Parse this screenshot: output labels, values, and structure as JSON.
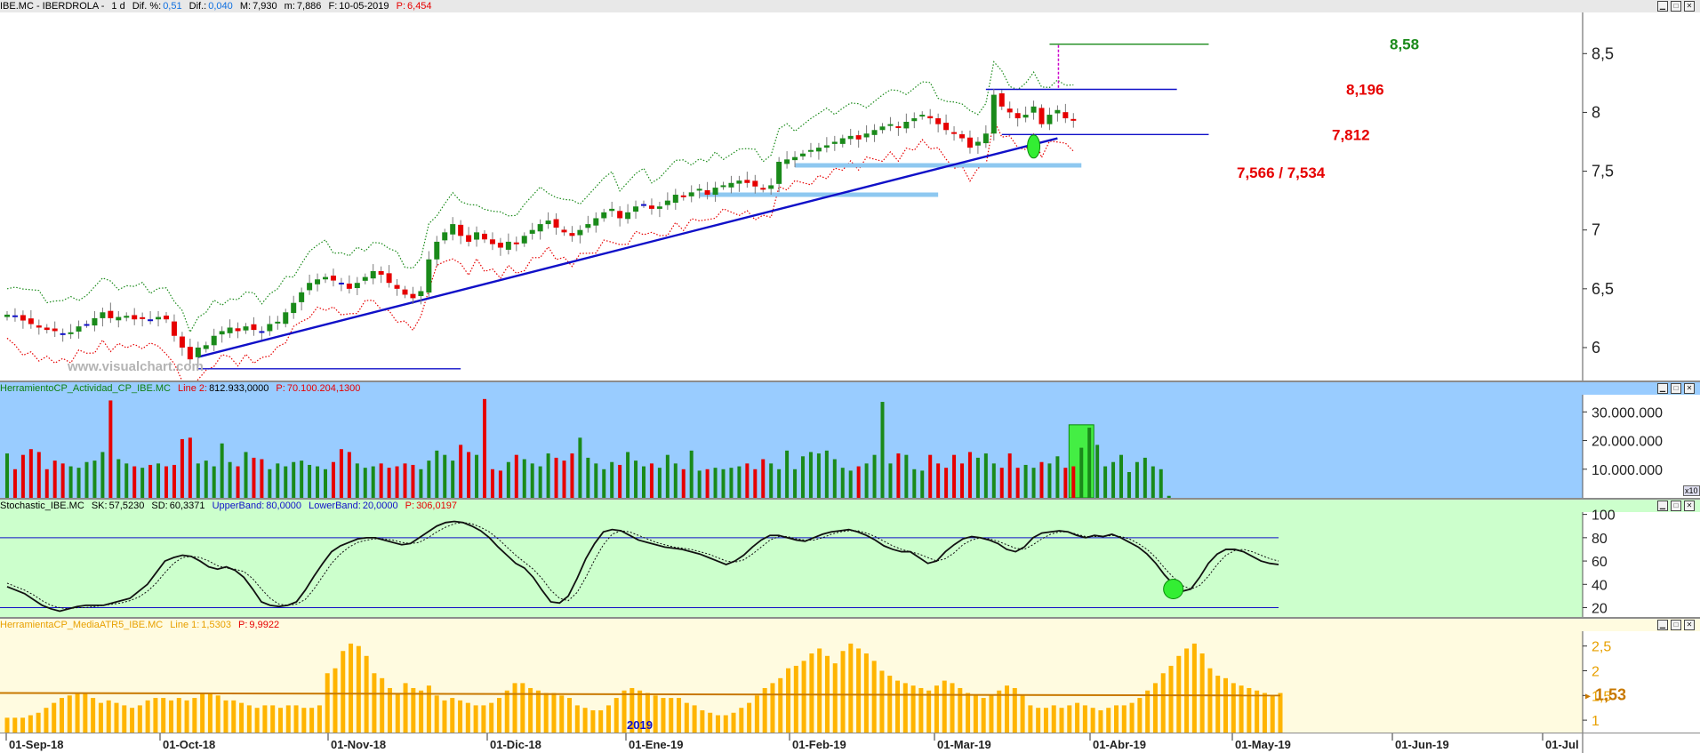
{
  "panes": {
    "price": {
      "header": {
        "symbol": "IBE.MC - IBERDROLA -",
        "period": "1 d",
        "dif_pct_label": "Dif. %:",
        "dif_pct": "0,51",
        "dif_label": "Dif.:",
        "dif": "0,040",
        "max_label": "M:",
        "max": "7,930",
        "min_label": "m:",
        "min": "7,886",
        "date_label": "F:",
        "date": "10-05-2019",
        "p_label": "P:",
        "p": "6,454"
      },
      "watermark": "www.visualchart.com",
      "annotations": [
        {
          "text": "8,58",
          "value": 8.58,
          "color": "#1a8a1a"
        },
        {
          "text": "8,196",
          "value": 8.196,
          "color": "#e60000"
        },
        {
          "text": "7,812",
          "value": 7.812,
          "color": "#e60000"
        },
        {
          "text": "7,566 / 7,534",
          "value": 7.55,
          "color": "#e60000"
        }
      ]
    },
    "volume": {
      "header": {
        "name": "HerramientoCP_Actividad_CP_IBE.MC",
        "line_label": "Line 2:",
        "line": "812.933,0000",
        "p_label": "P:",
        "p": "70.100.204,1300"
      },
      "multiplier": "x10"
    },
    "stochastic": {
      "header": {
        "name": "Stochastic_IBE.MC",
        "sk_label": "SK:",
        "sk": "57,5230",
        "sd_label": "SD:",
        "sd": "60,3371",
        "ub_label": "UpperBand:",
        "ub": "80,0000",
        "lb_label": "LowerBand:",
        "lb": "20,0000",
        "p_label": "P:",
        "p": "306,0197"
      }
    },
    "atr": {
      "header": {
        "name": "HerramientaCP_MediaATR5_IBE.MC",
        "line_label": "Line 1:",
        "line": "1,5303",
        "p_label": "P:",
        "p": "9,9922"
      },
      "current_label": "1,53"
    }
  },
  "x_axis": {
    "labels": [
      "01-Sep-18",
      "01-Oct-18",
      "01-Nov-18",
      "01-Dic-18",
      "01-Ene-19",
      "01-Feb-19",
      "01-Mar-19",
      "01-Abr-19",
      "01-May-19",
      "01-Jun-19",
      "01-Jul"
    ],
    "year_marker": "2019"
  },
  "colors": {
    "up": "#1a8a1a",
    "down": "#e60000",
    "neutral": "#1010c8",
    "trend": "#1010c8",
    "support_band": "#8ec8f0",
    "volume_bg": "#99ccff",
    "stoch_bg": "#ccffcc",
    "atr_bg": "#fffbe0",
    "atr_bar": "#ffb400",
    "atr_avg": "#c87800",
    "highlight": "#33ee33"
  },
  "chart_data": [
    {
      "type": "candlestick",
      "title": "IBE.MC - IBERDROLA",
      "ylim": [
        5.72,
        8.85
      ],
      "y_ticks": [
        {
          "value": 6,
          "label": "6"
        },
        {
          "value": 6.5,
          "label": "6,5"
        },
        {
          "value": 7,
          "label": "7"
        },
        {
          "value": 7.5,
          "label": "7,5"
        },
        {
          "value": 8,
          "label": "8"
        },
        {
          "value": 8.5,
          "label": "8,5"
        }
      ],
      "close": [
        6.28,
        6.27,
        6.23,
        6.2,
        6.17,
        6.15,
        6.14,
        6.12,
        6.13,
        6.18,
        6.2,
        6.25,
        6.3,
        6.25,
        6.26,
        6.27,
        6.24,
        6.25,
        6.24,
        6.26,
        6.24,
        6.1,
        6.0,
        5.9,
        6.0,
        6.02,
        6.1,
        6.14,
        6.17,
        6.14,
        6.18,
        6.15,
        6.14,
        6.2,
        6.22,
        6.3,
        6.38,
        6.47,
        6.55,
        6.58,
        6.6,
        6.57,
        6.55,
        6.5,
        6.55,
        6.6,
        6.65,
        6.62,
        6.55,
        6.5,
        6.45,
        6.42,
        6.48,
        6.75,
        6.9,
        6.98,
        7.05,
        6.95,
        6.9,
        6.98,
        6.92,
        6.88,
        6.85,
        6.9,
        6.88,
        6.95,
        7.0,
        7.05,
        7.08,
        7.02,
        6.98,
        6.95,
        7.0,
        7.05,
        7.1,
        7.15,
        7.18,
        7.1,
        7.15,
        7.2,
        7.22,
        7.18,
        7.2,
        7.25,
        7.3,
        7.28,
        7.32,
        7.35,
        7.3,
        7.36,
        7.38,
        7.4,
        7.42,
        7.4,
        7.37,
        7.35,
        7.38,
        7.58,
        7.6,
        7.62,
        7.65,
        7.68,
        7.7,
        7.72,
        7.75,
        7.78,
        7.8,
        7.77,
        7.82,
        7.85,
        7.88,
        7.9,
        7.87,
        7.92,
        7.95,
        7.98,
        7.95,
        7.9,
        7.85,
        7.82,
        7.78,
        7.7,
        7.75,
        7.82,
        8.15,
        8.05,
        8.0,
        7.95,
        7.98,
        8.05,
        7.9,
        7.98,
        8.02,
        7.95,
        7.93
      ],
      "series": [
        {
          "name": "Upper envelope",
          "color": "#1a8a1a",
          "style": "dotted"
        },
        {
          "name": "Lower envelope",
          "color": "#e60000",
          "style": "dotted"
        }
      ],
      "trendline": {
        "from": {
          "index": 24,
          "value": 5.92
        },
        "to": {
          "index": 132,
          "value": 7.78
        }
      },
      "horizontal_levels": [
        {
          "value": 5.82,
          "from_index": 24,
          "to_index": 57,
          "color": "#1010c8"
        },
        {
          "value": 7.3,
          "from_index": 87,
          "to_index": 117,
          "color": "#8ec8f0"
        },
        {
          "value": 7.55,
          "from_index": 99,
          "to_index": 135,
          "color": "#8ec8f0"
        },
        {
          "value": 7.812,
          "from_index": 125,
          "to_index": 151,
          "color": "#1010c8"
        },
        {
          "value": 8.196,
          "from_index": 123,
          "to_index": 147,
          "color": "#1010c8"
        },
        {
          "value": 8.58,
          "from_index": 131,
          "to_index": 151,
          "color": "#1a8a1a"
        }
      ]
    },
    {
      "type": "bar",
      "title": "HerramientoCP_Actividad_CP_IBE.MC",
      "ylim": [
        0,
        36000000
      ],
      "y_ticks": [
        {
          "value": 10000000,
          "label": "10.000.000"
        },
        {
          "value": 20000000,
          "label": "20.000.000"
        },
        {
          "value": 30000000,
          "label": "30.000.000"
        }
      ],
      "values": [
        15500000,
        10000000,
        15000000,
        17000000,
        16000000,
        10000000,
        13000000,
        12000000,
        11000000,
        10500000,
        12500000,
        13000000,
        16000000,
        34000000,
        13500000,
        12000000,
        11000000,
        10500000,
        11500000,
        12000000,
        11000000,
        11500000,
        20500000,
        21000000,
        12000000,
        13000000,
        11000000,
        19000000,
        12500000,
        11000000,
        16000000,
        14000000,
        13500000,
        10000000,
        12000000,
        11000000,
        12500000,
        13000000,
        11500000,
        11000000,
        10000000,
        12500000,
        17000000,
        16000000,
        12000000,
        10500000,
        11000000,
        12000000,
        10500000,
        11000000,
        12000000,
        11500000,
        10000000,
        13000000,
        16500000,
        15000000,
        13000000,
        18500000,
        16000000,
        15000000,
        34500000,
        10000000,
        9500000,
        12500000,
        15000000,
        13500000,
        12000000,
        11000000,
        15500000,
        14000000,
        13000000,
        15500000,
        21000000,
        14000000,
        12000000,
        10000000,
        12500000,
        11500000,
        16000000,
        13000000,
        11000000,
        12000000,
        10500000,
        15000000,
        12000000,
        10000000,
        16500000,
        9500000,
        10000000,
        10500000,
        10000000,
        10500000,
        11000000,
        12000000,
        10000000,
        13500000,
        12000000,
        10000000,
        16500000,
        10000000,
        14500000,
        16000000,
        15500000,
        16500000,
        13500000,
        10500000,
        9500000,
        11000000,
        12000000,
        15000000,
        33500000,
        12000000,
        15500000,
        15000000,
        10000000,
        9500000,
        15000000,
        12000000,
        10500000,
        15000000,
        12000000,
        16000000,
        14000000,
        15500000,
        12000000,
        10500000,
        15500000,
        10500000,
        11500000,
        10500000,
        12500000,
        12000000,
        14500000,
        10500000,
        11000000,
        17500000,
        24500000,
        18500000,
        11000000,
        12500000,
        15000000,
        9000000,
        12500000,
        14000000,
        11000000,
        10000000,
        700000
      ],
      "highlight_index_range": [
        134,
        136
      ]
    },
    {
      "type": "line",
      "title": "Stochastic_IBE.MC",
      "ylim": [
        12,
        102
      ],
      "y_ticks": [
        {
          "value": 20,
          "label": "20"
        },
        {
          "value": 40,
          "label": "40"
        },
        {
          "value": 60,
          "label": "60"
        },
        {
          "value": 80,
          "label": "80"
        },
        {
          "value": 100,
          "label": "100"
        }
      ],
      "bands": [
        80,
        20
      ],
      "series": [
        {
          "name": "SK",
          "style": "solid",
          "values": [
            38,
            35,
            32,
            27,
            22,
            19,
            17,
            19,
            21,
            22,
            22,
            22,
            24,
            26,
            28,
            34,
            40,
            50,
            60,
            63,
            65,
            64,
            60,
            55,
            53,
            55,
            52,
            46,
            36,
            25,
            22,
            21,
            22,
            25,
            35,
            47,
            58,
            68,
            73,
            76,
            79,
            80,
            80,
            78,
            76,
            74,
            75,
            80,
            85,
            90,
            93,
            94,
            93,
            90,
            86,
            80,
            72,
            65,
            58,
            54,
            46,
            35,
            25,
            24,
            30,
            45,
            62,
            75,
            85,
            87,
            86,
            82,
            78,
            76,
            74,
            72,
            71,
            70,
            68,
            66,
            63,
            60,
            57,
            60,
            65,
            72,
            78,
            82,
            82,
            80,
            78,
            77,
            80,
            83,
            85,
            86,
            87,
            85,
            82,
            78,
            73,
            70,
            68,
            68,
            63,
            58,
            60,
            68,
            74,
            79,
            81,
            80,
            78,
            75,
            70,
            68,
            72,
            80,
            84,
            85,
            86,
            85,
            82,
            80,
            82,
            81,
            83,
            80,
            76,
            72,
            66,
            58,
            48,
            40,
            34,
            36,
            46,
            58,
            66,
            70,
            70,
            68,
            64,
            60,
            58,
            57
          ]
        },
        {
          "name": "SD",
          "style": "dotted",
          "values": [
            41,
            38,
            35,
            31,
            26,
            22,
            20,
            19,
            20,
            20,
            21,
            22,
            23,
            24,
            26,
            29,
            34,
            41,
            50,
            58,
            63,
            64,
            63,
            60,
            56,
            54,
            53,
            51,
            45,
            36,
            28,
            23,
            22,
            23,
            27,
            36,
            47,
            58,
            66,
            72,
            76,
            78,
            79,
            79,
            78,
            76,
            75,
            76,
            80,
            85,
            89,
            92,
            93,
            92,
            89,
            85,
            79,
            72,
            65,
            59,
            53,
            45,
            35,
            28,
            26,
            33,
            46,
            61,
            74,
            83,
            86,
            85,
            82,
            79,
            76,
            74,
            72,
            71,
            70,
            68,
            66,
            63,
            60,
            59,
            61,
            66,
            72,
            78,
            81,
            81,
            79,
            78,
            78,
            80,
            83,
            85,
            86,
            86,
            84,
            81,
            77,
            73,
            70,
            68,
            66,
            63,
            60,
            62,
            67,
            74,
            78,
            80,
            79,
            77,
            74,
            71,
            70,
            74,
            79,
            83,
            85,
            85,
            83,
            81,
            81,
            81,
            82,
            81,
            79,
            75,
            70,
            63,
            54,
            46,
            39,
            36,
            39,
            47,
            57,
            65,
            69,
            70,
            68,
            65,
            62,
            60
          ]
        }
      ]
    },
    {
      "type": "bar",
      "title": "HerramientaCP_MediaATR5_IBE.MC",
      "ylim": [
        0.75,
        2.8
      ],
      "y_ticks": [
        {
          "value": 1,
          "label": "1"
        },
        {
          "value": 1.5,
          "label": "1,5"
        },
        {
          "value": 2,
          "label": "2"
        },
        {
          "value": 2.5,
          "label": "2,5"
        }
      ],
      "values": [
        1.05,
        1.05,
        1.05,
        1.1,
        1.15,
        1.25,
        1.35,
        1.45,
        1.5,
        1.55,
        1.55,
        1.45,
        1.35,
        1.4,
        1.35,
        1.3,
        1.25,
        1.3,
        1.4,
        1.45,
        1.45,
        1.4,
        1.45,
        1.4,
        1.45,
        1.55,
        1.55,
        1.5,
        1.4,
        1.4,
        1.35,
        1.3,
        1.25,
        1.3,
        1.3,
        1.25,
        1.3,
        1.3,
        1.25,
        1.25,
        1.3,
        1.95,
        2.05,
        2.4,
        2.55,
        2.5,
        2.3,
        1.95,
        1.85,
        1.65,
        1.55,
        1.75,
        1.65,
        1.6,
        1.7,
        1.5,
        1.4,
        1.45,
        1.4,
        1.35,
        1.3,
        1.3,
        1.35,
        1.45,
        1.6,
        1.75,
        1.75,
        1.65,
        1.6,
        1.55,
        1.55,
        1.5,
        1.45,
        1.3,
        1.25,
        1.2,
        1.2,
        1.3,
        1.45,
        1.6,
        1.65,
        1.6,
        1.55,
        1.5,
        1.45,
        1.45,
        1.45,
        1.35,
        1.3,
        1.2,
        1.15,
        1.1,
        1.1,
        1.15,
        1.25,
        1.35,
        1.5,
        1.65,
        1.75,
        1.85,
        2.05,
        2.1,
        2.2,
        2.35,
        2.45,
        2.3,
        2.15,
        2.4,
        2.55,
        2.45,
        2.35,
        2.2,
        2.0,
        1.9,
        1.8,
        1.75,
        1.7,
        1.65,
        1.6,
        1.7,
        1.8,
        1.75,
        1.65,
        1.55,
        1.5,
        1.45,
        1.5,
        1.6,
        1.7,
        1.65,
        1.5,
        1.3,
        1.25,
        1.25,
        1.3,
        1.25,
        1.3,
        1.35,
        1.3,
        1.25,
        1.2,
        1.25,
        1.3,
        1.3,
        1.35,
        1.45,
        1.6,
        1.75,
        1.95,
        2.1,
        2.3,
        2.45,
        2.55,
        2.35,
        2.05,
        1.9,
        1.85,
        1.75,
        1.7,
        1.65,
        1.6,
        1.55,
        1.5,
        1.55
      ],
      "average": {
        "from": 1.55,
        "to": 1.5
      }
    }
  ]
}
